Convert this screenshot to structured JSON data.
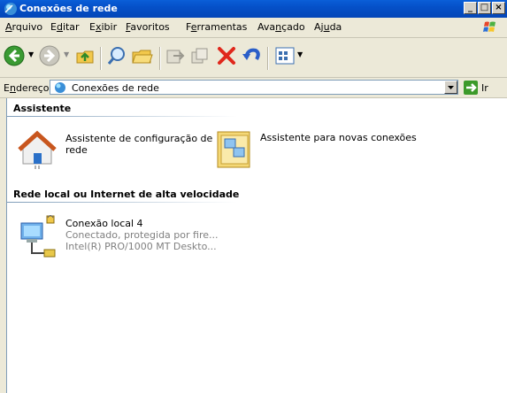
{
  "window": {
    "title": "Conexões de rede"
  },
  "menu": [
    {
      "pre": "",
      "ul": "A",
      "post": "rquivo"
    },
    {
      "pre": "E",
      "ul": "d",
      "post": "itar"
    },
    {
      "pre": "E",
      "ul": "x",
      "post": "ibir"
    },
    {
      "pre": "",
      "ul": "F",
      "post": "avoritos"
    },
    {
      "pre": "F",
      "ul": "e",
      "post": "rramentas"
    },
    {
      "pre": "Ava",
      "ul": "n",
      "post": "çado"
    },
    {
      "pre": "Aj",
      "ul": "u",
      "post": "da"
    }
  ],
  "address": {
    "label_pre": "E",
    "label_ul": "n",
    "label_post": "dereço",
    "value": "Conexões de rede",
    "go": "Ir"
  },
  "groups": {
    "wizard": "Assistente",
    "lan": "Rede local ou Internet de alta velocidade"
  },
  "items": {
    "home_wizard": {
      "line1": "Assistente de configuração de",
      "line2": "rede"
    },
    "new_conn": {
      "line1": "Assistente para novas conexões"
    },
    "lan": {
      "name": "Conexão local 4",
      "status": "Conectado, protegida por fire...",
      "device": "Intel(R) PRO/1000 MT Deskto..."
    }
  }
}
